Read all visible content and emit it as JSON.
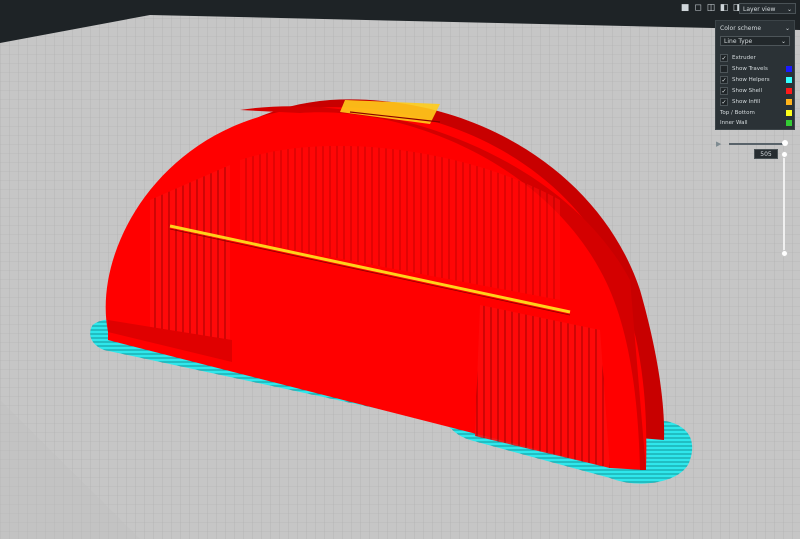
{
  "toolbar": {
    "view_icons": [
      "view-3d-icon",
      "view-front-icon",
      "view-top-icon",
      "view-left-icon",
      "view-right-icon"
    ],
    "view_mode": "Layer view"
  },
  "panel": {
    "color_scheme_label": "Color scheme",
    "scheme_value": "Line Type",
    "items": [
      {
        "label": "Extruder",
        "checked": true,
        "color": ""
      },
      {
        "label": "Show Travels",
        "checked": false,
        "color": "#1a1aff"
      },
      {
        "label": "Show Helpers",
        "checked": true,
        "color": "#33ffff"
      },
      {
        "label": "Show Shell",
        "checked": true,
        "color": "#ff1a1a"
      },
      {
        "label": "Show Infill",
        "checked": true,
        "color": "#ffb31a"
      },
      {
        "label": "Top / Bottom",
        "checked": null,
        "color": "#ffff1a"
      },
      {
        "label": "Inner Wall",
        "checked": null,
        "color": "#33cc33"
      }
    ]
  },
  "layer": {
    "current": "505"
  },
  "colors": {
    "shell": "#ff0000",
    "helpers": "#2ee8ec",
    "bed": "#c3c3c3",
    "background": "#1e2326"
  }
}
